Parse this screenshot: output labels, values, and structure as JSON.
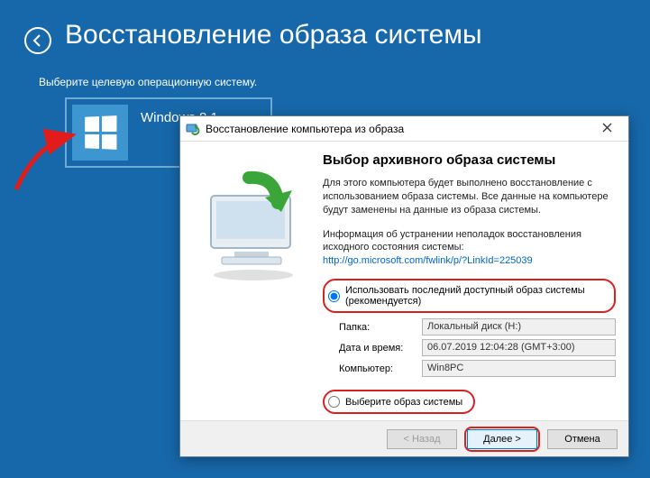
{
  "header": {
    "title": "Восстановление образа системы",
    "subtitle": "Выберите целевую операционную систему."
  },
  "os_tile": {
    "name": "Windows 8.1"
  },
  "dialog": {
    "title": "Восстановление компьютера из образа",
    "heading": "Выбор архивного образа системы",
    "body_para": "Для этого компьютера будет выполнено восстановление с использованием образа системы. Все данные на компьютере будут заменены на данные из образа системы.",
    "info_text": "Информация об устранении неполадок восстановления исходного состояния системы:",
    "info_link": "http://go.microsoft.com/fwlink/p/?LinkId=225039",
    "radios": {
      "use_latest": "Использовать последний доступный образ системы (рекомендуется)",
      "select_image": "Выберите образ системы"
    },
    "fields": {
      "folder_label": "Папка:",
      "folder_value": "Локальный диск (H:)",
      "datetime_label": "Дата и время:",
      "datetime_value": "06.07.2019 12:04:28 (GMT+3:00)",
      "computer_label": "Компьютер:",
      "computer_value": "Win8PC"
    },
    "buttons": {
      "back": "< Назад",
      "next": "Далее >",
      "cancel": "Отмена"
    }
  }
}
